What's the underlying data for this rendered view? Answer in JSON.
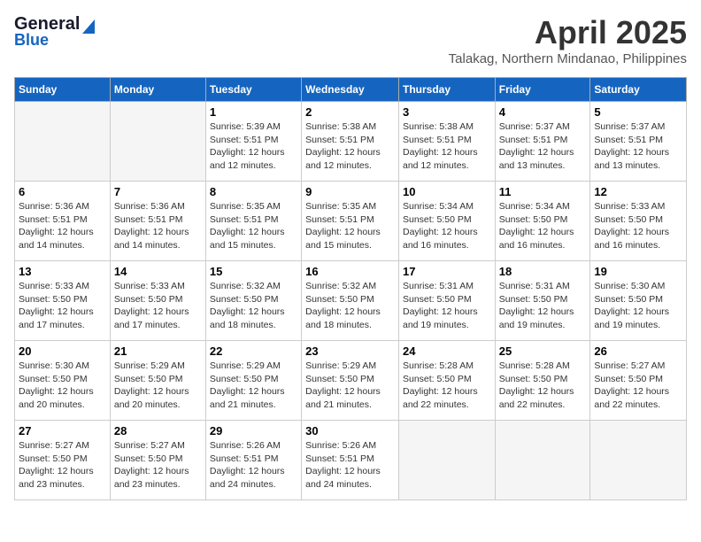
{
  "logo": {
    "general": "General",
    "blue": "Blue"
  },
  "title": "April 2025",
  "location": "Talakag, Northern Mindanao, Philippines",
  "days_of_week": [
    "Sunday",
    "Monday",
    "Tuesday",
    "Wednesday",
    "Thursday",
    "Friday",
    "Saturday"
  ],
  "weeks": [
    [
      {
        "day": "",
        "sunrise": "",
        "sunset": "",
        "daylight": ""
      },
      {
        "day": "",
        "sunrise": "",
        "sunset": "",
        "daylight": ""
      },
      {
        "day": "1",
        "sunrise": "Sunrise: 5:39 AM",
        "sunset": "Sunset: 5:51 PM",
        "daylight": "Daylight: 12 hours and 12 minutes."
      },
      {
        "day": "2",
        "sunrise": "Sunrise: 5:38 AM",
        "sunset": "Sunset: 5:51 PM",
        "daylight": "Daylight: 12 hours and 12 minutes."
      },
      {
        "day": "3",
        "sunrise": "Sunrise: 5:38 AM",
        "sunset": "Sunset: 5:51 PM",
        "daylight": "Daylight: 12 hours and 12 minutes."
      },
      {
        "day": "4",
        "sunrise": "Sunrise: 5:37 AM",
        "sunset": "Sunset: 5:51 PM",
        "daylight": "Daylight: 12 hours and 13 minutes."
      },
      {
        "day": "5",
        "sunrise": "Sunrise: 5:37 AM",
        "sunset": "Sunset: 5:51 PM",
        "daylight": "Daylight: 12 hours and 13 minutes."
      }
    ],
    [
      {
        "day": "6",
        "sunrise": "Sunrise: 5:36 AM",
        "sunset": "Sunset: 5:51 PM",
        "daylight": "Daylight: 12 hours and 14 minutes."
      },
      {
        "day": "7",
        "sunrise": "Sunrise: 5:36 AM",
        "sunset": "Sunset: 5:51 PM",
        "daylight": "Daylight: 12 hours and 14 minutes."
      },
      {
        "day": "8",
        "sunrise": "Sunrise: 5:35 AM",
        "sunset": "Sunset: 5:51 PM",
        "daylight": "Daylight: 12 hours and 15 minutes."
      },
      {
        "day": "9",
        "sunrise": "Sunrise: 5:35 AM",
        "sunset": "Sunset: 5:51 PM",
        "daylight": "Daylight: 12 hours and 15 minutes."
      },
      {
        "day": "10",
        "sunrise": "Sunrise: 5:34 AM",
        "sunset": "Sunset: 5:50 PM",
        "daylight": "Daylight: 12 hours and 16 minutes."
      },
      {
        "day": "11",
        "sunrise": "Sunrise: 5:34 AM",
        "sunset": "Sunset: 5:50 PM",
        "daylight": "Daylight: 12 hours and 16 minutes."
      },
      {
        "day": "12",
        "sunrise": "Sunrise: 5:33 AM",
        "sunset": "Sunset: 5:50 PM",
        "daylight": "Daylight: 12 hours and 16 minutes."
      }
    ],
    [
      {
        "day": "13",
        "sunrise": "Sunrise: 5:33 AM",
        "sunset": "Sunset: 5:50 PM",
        "daylight": "Daylight: 12 hours and 17 minutes."
      },
      {
        "day": "14",
        "sunrise": "Sunrise: 5:33 AM",
        "sunset": "Sunset: 5:50 PM",
        "daylight": "Daylight: 12 hours and 17 minutes."
      },
      {
        "day": "15",
        "sunrise": "Sunrise: 5:32 AM",
        "sunset": "Sunset: 5:50 PM",
        "daylight": "Daylight: 12 hours and 18 minutes."
      },
      {
        "day": "16",
        "sunrise": "Sunrise: 5:32 AM",
        "sunset": "Sunset: 5:50 PM",
        "daylight": "Daylight: 12 hours and 18 minutes."
      },
      {
        "day": "17",
        "sunrise": "Sunrise: 5:31 AM",
        "sunset": "Sunset: 5:50 PM",
        "daylight": "Daylight: 12 hours and 19 minutes."
      },
      {
        "day": "18",
        "sunrise": "Sunrise: 5:31 AM",
        "sunset": "Sunset: 5:50 PM",
        "daylight": "Daylight: 12 hours and 19 minutes."
      },
      {
        "day": "19",
        "sunrise": "Sunrise: 5:30 AM",
        "sunset": "Sunset: 5:50 PM",
        "daylight": "Daylight: 12 hours and 19 minutes."
      }
    ],
    [
      {
        "day": "20",
        "sunrise": "Sunrise: 5:30 AM",
        "sunset": "Sunset: 5:50 PM",
        "daylight": "Daylight: 12 hours and 20 minutes."
      },
      {
        "day": "21",
        "sunrise": "Sunrise: 5:29 AM",
        "sunset": "Sunset: 5:50 PM",
        "daylight": "Daylight: 12 hours and 20 minutes."
      },
      {
        "day": "22",
        "sunrise": "Sunrise: 5:29 AM",
        "sunset": "Sunset: 5:50 PM",
        "daylight": "Daylight: 12 hours and 21 minutes."
      },
      {
        "day": "23",
        "sunrise": "Sunrise: 5:29 AM",
        "sunset": "Sunset: 5:50 PM",
        "daylight": "Daylight: 12 hours and 21 minutes."
      },
      {
        "day": "24",
        "sunrise": "Sunrise: 5:28 AM",
        "sunset": "Sunset: 5:50 PM",
        "daylight": "Daylight: 12 hours and 22 minutes."
      },
      {
        "day": "25",
        "sunrise": "Sunrise: 5:28 AM",
        "sunset": "Sunset: 5:50 PM",
        "daylight": "Daylight: 12 hours and 22 minutes."
      },
      {
        "day": "26",
        "sunrise": "Sunrise: 5:27 AM",
        "sunset": "Sunset: 5:50 PM",
        "daylight": "Daylight: 12 hours and 22 minutes."
      }
    ],
    [
      {
        "day": "27",
        "sunrise": "Sunrise: 5:27 AM",
        "sunset": "Sunset: 5:50 PM",
        "daylight": "Daylight: 12 hours and 23 minutes."
      },
      {
        "day": "28",
        "sunrise": "Sunrise: 5:27 AM",
        "sunset": "Sunset: 5:50 PM",
        "daylight": "Daylight: 12 hours and 23 minutes."
      },
      {
        "day": "29",
        "sunrise": "Sunrise: 5:26 AM",
        "sunset": "Sunset: 5:51 PM",
        "daylight": "Daylight: 12 hours and 24 minutes."
      },
      {
        "day": "30",
        "sunrise": "Sunrise: 5:26 AM",
        "sunset": "Sunset: 5:51 PM",
        "daylight": "Daylight: 12 hours and 24 minutes."
      },
      {
        "day": "",
        "sunrise": "",
        "sunset": "",
        "daylight": ""
      },
      {
        "day": "",
        "sunrise": "",
        "sunset": "",
        "daylight": ""
      },
      {
        "day": "",
        "sunrise": "",
        "sunset": "",
        "daylight": ""
      }
    ]
  ]
}
